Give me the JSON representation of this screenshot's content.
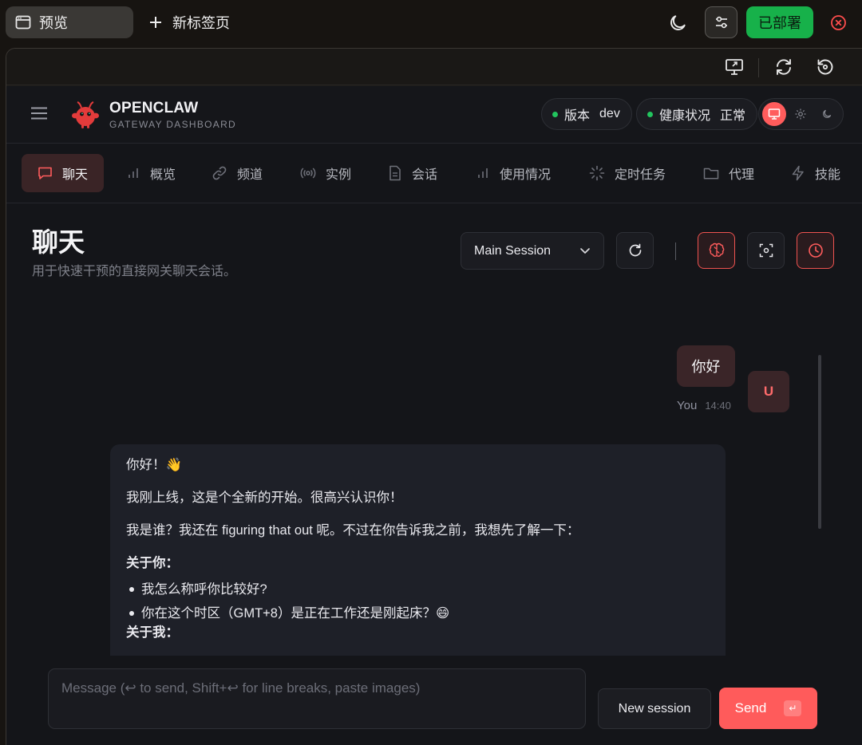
{
  "browser": {
    "active_tab_label": "预览",
    "new_tab_label": "新标签页",
    "deploy_label": "已部署"
  },
  "header": {
    "brand_title": "OPENCLAW",
    "brand_subtitle": "GATEWAY DASHBOARD",
    "version_label": "版本",
    "version_value": "dev",
    "health_label": "健康状况",
    "health_value": "正常"
  },
  "nav": {
    "items": [
      {
        "label": "聊天",
        "icon": "message-icon"
      },
      {
        "label": "概览",
        "icon": "bar-chart-icon"
      },
      {
        "label": "频道",
        "icon": "link-icon"
      },
      {
        "label": "实例",
        "icon": "broadcast-icon"
      },
      {
        "label": "会话",
        "icon": "file-icon"
      },
      {
        "label": "使用情况",
        "icon": "bar-chart-icon"
      },
      {
        "label": "定时任务",
        "icon": "loader-icon"
      },
      {
        "label": "代理",
        "icon": "folder-icon"
      },
      {
        "label": "技能",
        "icon": "zap-icon"
      }
    ]
  },
  "page": {
    "title": "聊天",
    "subtitle": "用于快速干预的直接网关聊天会话。",
    "session_value": "Main Session"
  },
  "chat": {
    "user_message": "你好",
    "user_name": "You",
    "user_time": "14:40",
    "avatar_letter": "U",
    "assistant_lines": [
      "你好！👋",
      "我刚上线，这是个全新的开始。很高兴认识你！",
      "我是谁？我还在 figuring that out 呢。不过在你告诉我之前，我想先了解一下："
    ],
    "about_you_heading": "关于你：",
    "about_you_items": [
      "我怎么称呼你比较好?",
      "你在这个时区（GMT+8）是正在工作还是刚起床？😄"
    ],
    "about_me_heading": "关于我："
  },
  "composer": {
    "placeholder": "Message (↩ to send, Shift+↩ for line breaks, paste images)",
    "new_session_label": "New session",
    "send_label": "Send",
    "send_kbd": "↵"
  },
  "colors": {
    "accent": "#ff5c5c",
    "deploy_green": "#17b14a",
    "status_green": "#22c55e",
    "background": "#141519"
  }
}
